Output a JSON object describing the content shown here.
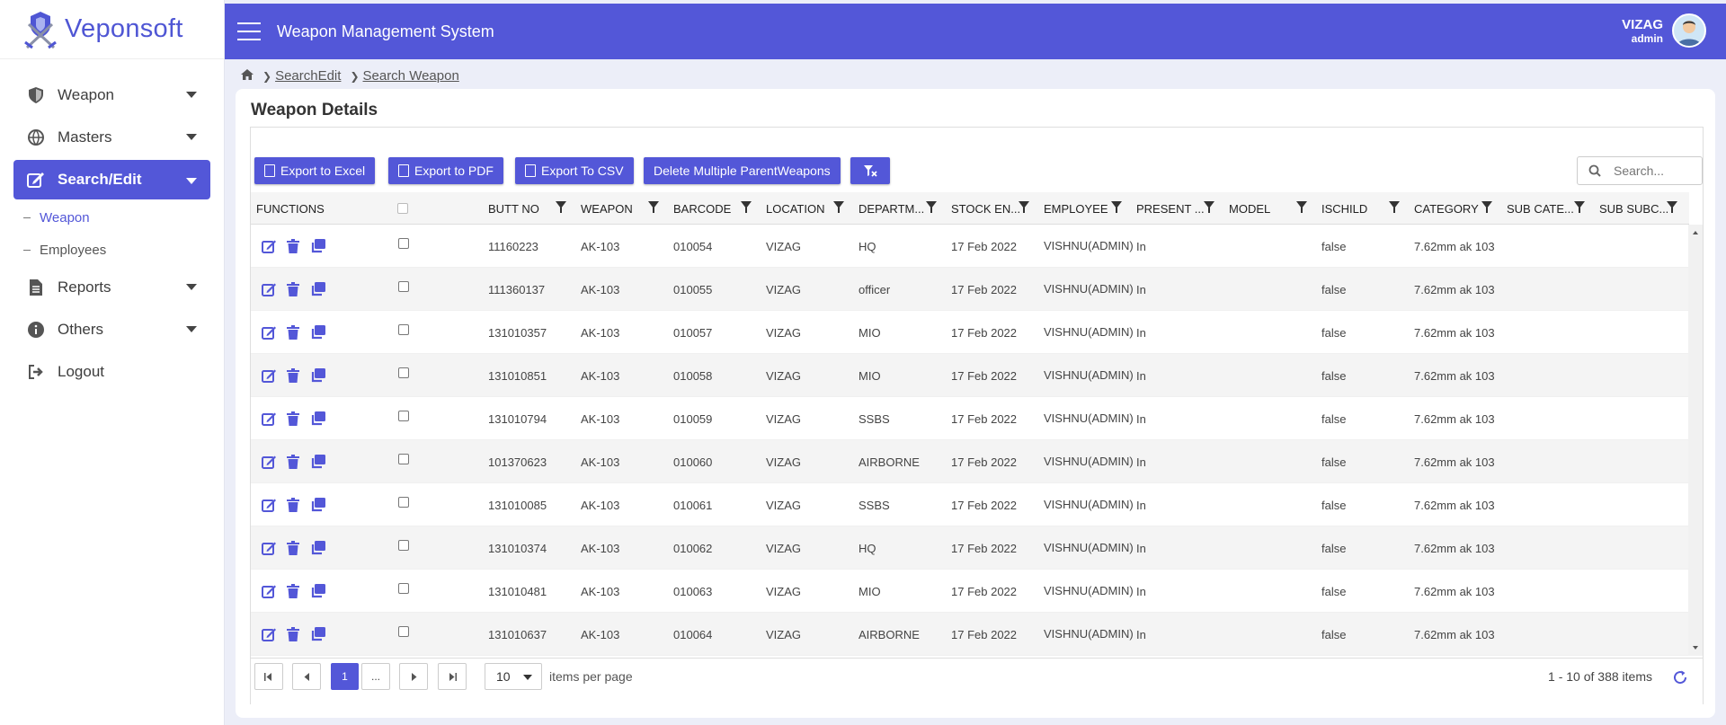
{
  "app": {
    "logo_text": "Veponsoft",
    "header_title": "Weapon Management System",
    "user_name": "VIZAG",
    "user_role": "admin"
  },
  "sidebar": {
    "items": [
      {
        "label": "Weapon",
        "icon": "shield-icon",
        "has_caret": true
      },
      {
        "label": "Masters",
        "icon": "globe-icon",
        "has_caret": true
      },
      {
        "label": "Search/Edit",
        "icon": "edit-icon",
        "has_caret": true,
        "active": true
      },
      {
        "label": "Reports",
        "icon": "document-icon",
        "has_caret": true
      },
      {
        "label": "Others",
        "icon": "info-icon",
        "has_caret": true
      },
      {
        "label": "Logout",
        "icon": "logout-icon",
        "has_caret": false
      }
    ],
    "sub_items": [
      {
        "label": "Weapon",
        "active": true
      },
      {
        "label": "Employees",
        "active": false
      }
    ]
  },
  "breadcrumb": {
    "items": [
      "SearchEdit",
      "Search Weapon"
    ]
  },
  "page": {
    "title": "Weapon Details"
  },
  "toolbar": {
    "export_excel": "Export to Excel",
    "export_pdf": "Export to PDF",
    "export_csv": "Export To CSV",
    "delete_multiple": "Delete Multiple ParentWeapons",
    "search_placeholder": "Search..."
  },
  "table": {
    "columns": [
      "FUNCTIONS",
      "",
      "BUTT NO",
      "WEAPON",
      "BARCODE",
      "LOCATION",
      "DEPARTM...",
      "STOCK EN...",
      "EMPLOYEE",
      "PRESENT ...",
      "MODEL",
      "ISCHILD",
      "CATEGORY",
      "SUB CATE...",
      "SUB SUBC..."
    ],
    "rows": [
      {
        "butt_no": "11160223",
        "weapon": "AK-103",
        "barcode": "010054",
        "location": "VIZAG",
        "department": "HQ",
        "stock": "17 Feb 2022",
        "employee": "VISHNU(ADMIN)",
        "present": "In",
        "model": "",
        "ischild": "false",
        "category": "7.62mm ak 103"
      },
      {
        "butt_no": "111360137",
        "weapon": "AK-103",
        "barcode": "010055",
        "location": "VIZAG",
        "department": "officer",
        "stock": "17 Feb 2022",
        "employee": "VISHNU(ADMIN)",
        "present": "In",
        "model": "",
        "ischild": "false",
        "category": "7.62mm ak 103"
      },
      {
        "butt_no": "131010357",
        "weapon": "AK-103",
        "barcode": "010057",
        "location": "VIZAG",
        "department": "MIO",
        "stock": "17 Feb 2022",
        "employee": "VISHNU(ADMIN)",
        "present": "In",
        "model": "",
        "ischild": "false",
        "category": "7.62mm ak 103"
      },
      {
        "butt_no": "131010851",
        "weapon": "AK-103",
        "barcode": "010058",
        "location": "VIZAG",
        "department": "MIO",
        "stock": "17 Feb 2022",
        "employee": "VISHNU(ADMIN)",
        "present": "In",
        "model": "",
        "ischild": "false",
        "category": "7.62mm ak 103"
      },
      {
        "butt_no": "131010794",
        "weapon": "AK-103",
        "barcode": "010059",
        "location": "VIZAG",
        "department": "SSBS",
        "stock": "17 Feb 2022",
        "employee": "VISHNU(ADMIN)",
        "present": "In",
        "model": "",
        "ischild": "false",
        "category": "7.62mm ak 103"
      },
      {
        "butt_no": "101370623",
        "weapon": "AK-103",
        "barcode": "010060",
        "location": "VIZAG",
        "department": "AIRBORNE",
        "stock": "17 Feb 2022",
        "employee": "VISHNU(ADMIN)",
        "present": "In",
        "model": "",
        "ischild": "false",
        "category": "7.62mm ak 103"
      },
      {
        "butt_no": "131010085",
        "weapon": "AK-103",
        "barcode": "010061",
        "location": "VIZAG",
        "department": "SSBS",
        "stock": "17 Feb 2022",
        "employee": "VISHNU(ADMIN)",
        "present": "In",
        "model": "",
        "ischild": "false",
        "category": "7.62mm ak 103"
      },
      {
        "butt_no": "131010374",
        "weapon": "AK-103",
        "barcode": "010062",
        "location": "VIZAG",
        "department": "HQ",
        "stock": "17 Feb 2022",
        "employee": "VISHNU(ADMIN)",
        "present": "In",
        "model": "",
        "ischild": "false",
        "category": "7.62mm ak 103"
      },
      {
        "butt_no": "131010481",
        "weapon": "AK-103",
        "barcode": "010063",
        "location": "VIZAG",
        "department": "MIO",
        "stock": "17 Feb 2022",
        "employee": "VISHNU(ADMIN)",
        "present": "In",
        "model": "",
        "ischild": "false",
        "category": "7.62mm ak 103"
      },
      {
        "butt_no": "131010637",
        "weapon": "AK-103",
        "barcode": "010064",
        "location": "VIZAG",
        "department": "AIRBORNE",
        "stock": "17 Feb 2022",
        "employee": "VISHNU(ADMIN)",
        "present": "In",
        "model": "",
        "ischild": "false",
        "category": "7.62mm ak 103"
      }
    ]
  },
  "pager": {
    "current_page": "1",
    "more": "...",
    "page_size": "10",
    "page_size_label": "items per page",
    "info": "1 - 10 of 388 items"
  },
  "colors": {
    "accent": "#5357d8",
    "background": "#eceef8"
  }
}
